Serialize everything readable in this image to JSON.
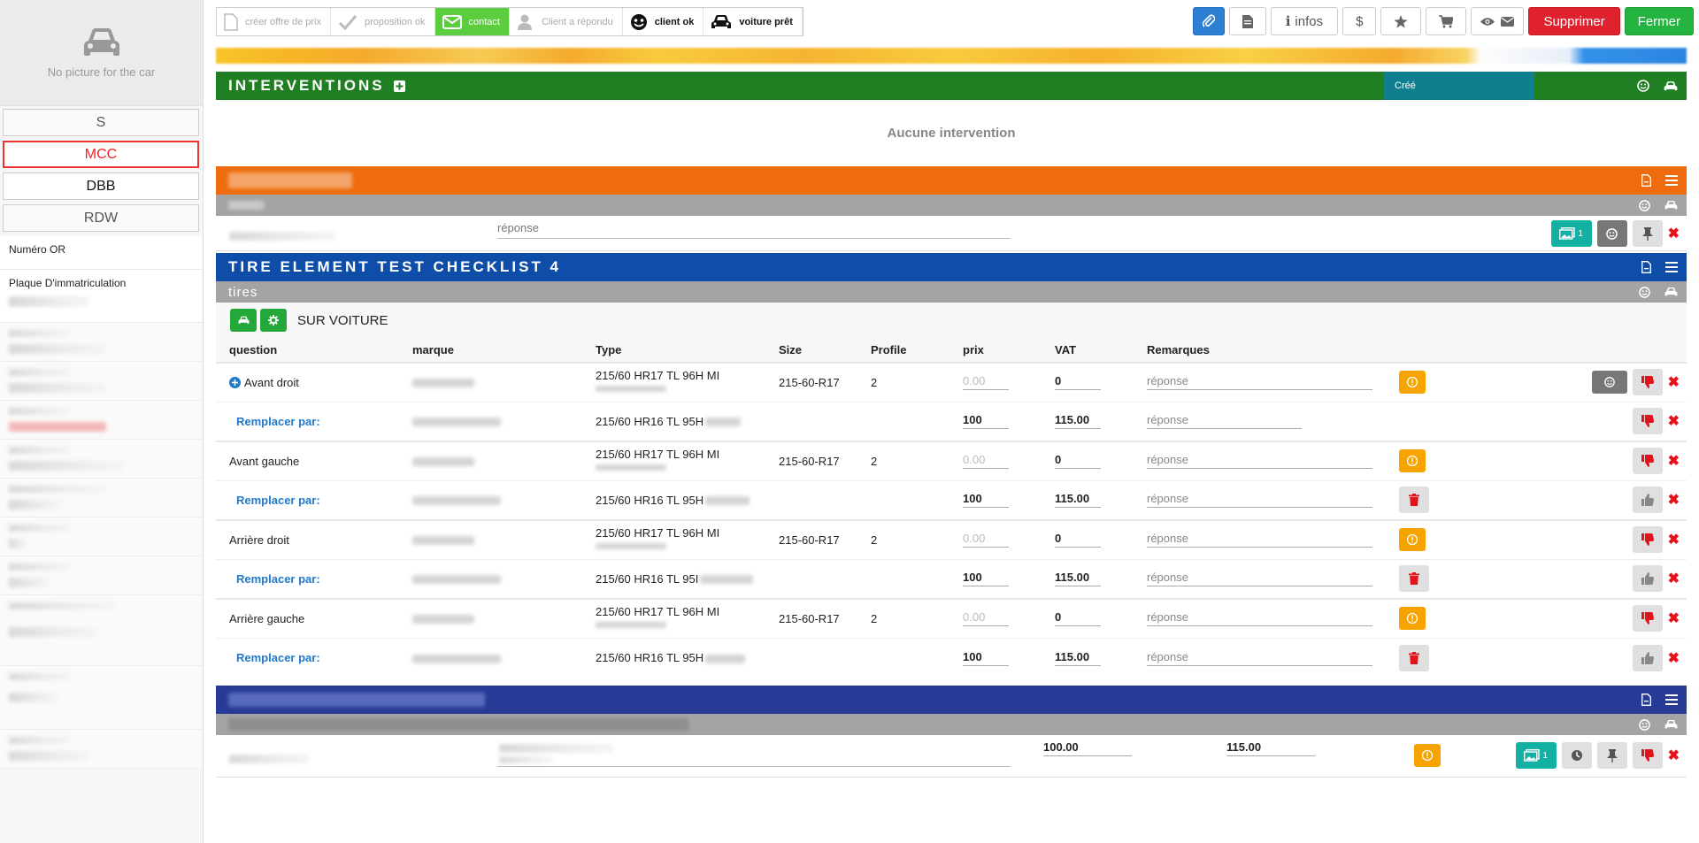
{
  "sidebar": {
    "no_picture": "No picture for the car",
    "tabs": [
      "S",
      "MCC",
      "DBB",
      "RDW"
    ],
    "fields": {
      "numero_or": "Numéro OR",
      "plaque": "Plaque D'immatriculation"
    }
  },
  "steps": [
    {
      "label": "créer offre de prix",
      "state": "done"
    },
    {
      "label": "proposition ok",
      "state": "done"
    },
    {
      "label": "contact",
      "state": "active"
    },
    {
      "label": "Client a répondu",
      "state": "todo"
    },
    {
      "label": "client ok",
      "state": "dark"
    },
    {
      "label": "voiture prêt",
      "state": "dark"
    }
  ],
  "toolbar": {
    "infos": "infos",
    "dollar": "$",
    "delete": "Supprimer",
    "close": "Fermer"
  },
  "interventions": {
    "title": "INTERVENTIONS",
    "status": "Créé",
    "empty": "Aucune intervention"
  },
  "section_orange": {
    "answer_placeholder": "réponse",
    "photo_count": "1"
  },
  "tire_section": {
    "title": "TIRE ELEMENT TEST CHECKLIST 4",
    "subtitle": "tires",
    "sur_voiture": "SUR VOITURE",
    "columns": [
      "question",
      "marque",
      "Type",
      "Size",
      "Profile",
      "prix",
      "VAT",
      "Remarques"
    ],
    "replace_label": "Remplacer par:",
    "rows": [
      {
        "question": "Avant droit",
        "type": "215/60 HR17 TL 96H MI",
        "size": "215-60-R17",
        "profile": "2",
        "prix": "0.00",
        "vat": "0",
        "repl_type": "215/60 HR16 TL 95H",
        "repl_prix": "100",
        "repl_vat": "115.00"
      },
      {
        "question": "Avant gauche",
        "type": "215/60 HR17 TL 96H MI",
        "size": "215-60-R17",
        "profile": "2",
        "prix": "0.00",
        "vat": "0",
        "repl_type": "215/60 HR16 TL 95H",
        "repl_prix": "100",
        "repl_vat": "115.00"
      },
      {
        "question": "Arrière droit",
        "type": "215/60 HR17 TL 96H MI",
        "size": "215-60-R17",
        "profile": "2",
        "prix": "0.00",
        "vat": "0",
        "repl_type": "215/60 HR16 TL 95I",
        "repl_prix": "100",
        "repl_vat": "115.00"
      },
      {
        "question": "Arrière gauche",
        "type": "215/60 HR17 TL 96H MI",
        "size": "215-60-R17",
        "profile": "2",
        "prix": "0.00",
        "vat": "0",
        "repl_type": "215/60 HR16 TL 95H",
        "repl_prix": "100",
        "repl_vat": "115.00"
      }
    ],
    "remark_placeholder": "réponse"
  },
  "bottom_section": {
    "price": "100.00",
    "vat": "115.00",
    "photo_count": "1"
  },
  "colors": {
    "green": "#1f7f22",
    "orange": "#ee6c0d",
    "blue": "#0f4ea8",
    "navy": "#263a96",
    "red": "#e0212e",
    "step_active": "#5ccd3f"
  }
}
